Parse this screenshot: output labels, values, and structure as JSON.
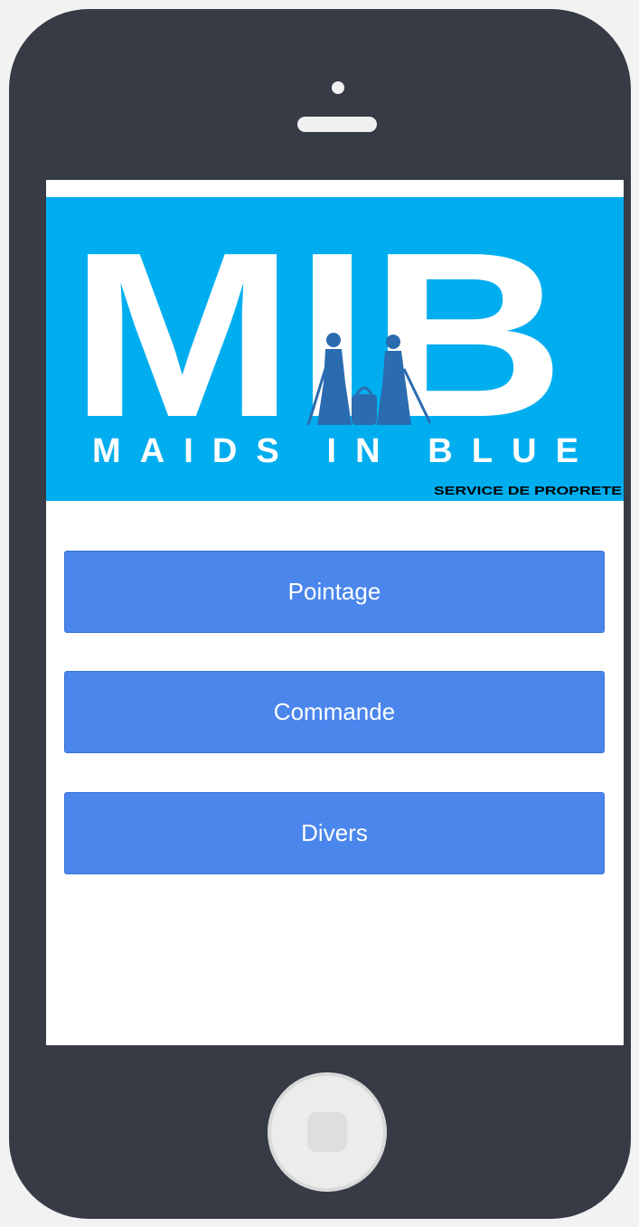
{
  "logo": {
    "big_letters": "MIB",
    "name": "MAIDS IN BLUE",
    "tagline": "SERVICE DE PROPRETE"
  },
  "buttons": [
    {
      "label": "Pointage"
    },
    {
      "label": "Commande"
    },
    {
      "label": "Divers"
    }
  ],
  "colors": {
    "phone_body": "#363b46",
    "banner": "#00aeef",
    "button": "#4a86ec",
    "button_text": "#ffffff"
  }
}
